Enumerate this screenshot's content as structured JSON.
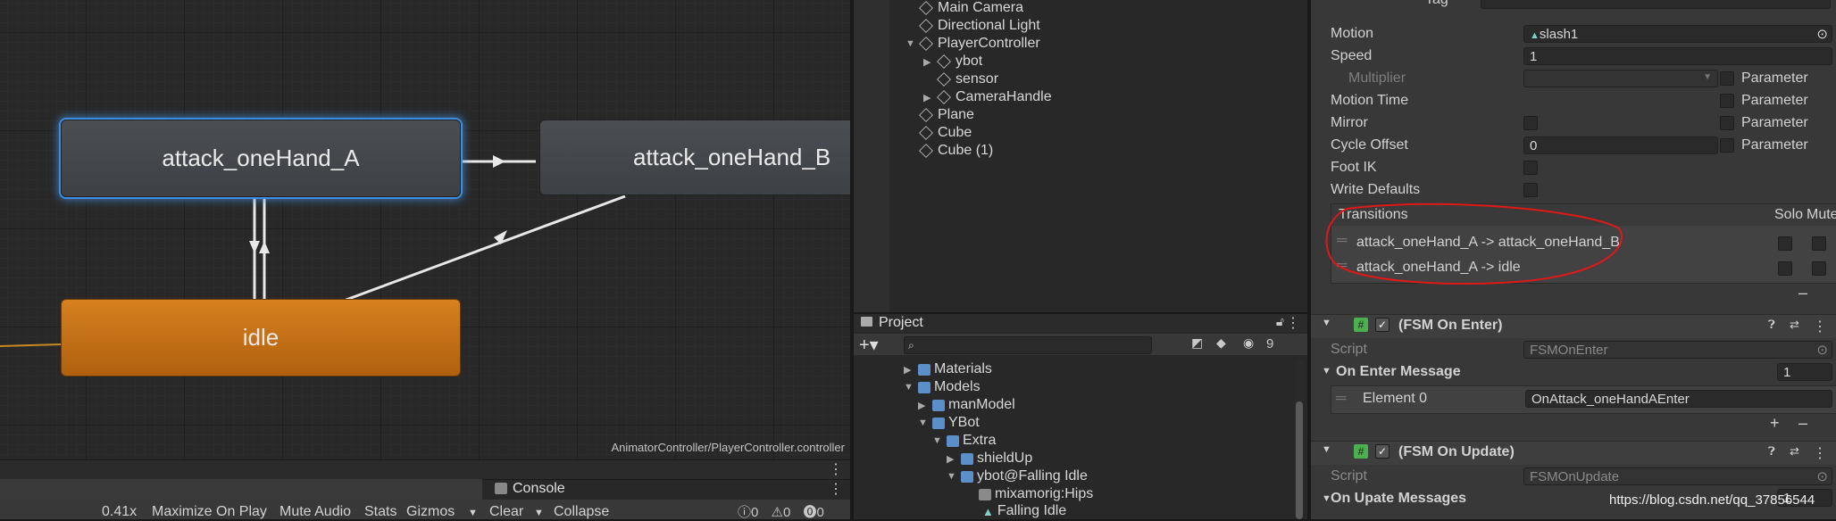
{
  "animator": {
    "nodes": {
      "attack_a": "attack_oneHand_A",
      "attack_b": "attack_oneHand_B",
      "idle": "idle"
    },
    "breadcrumb": "AnimatorController/PlayerController.controller"
  },
  "scene_toolbar": {
    "zoom": "0.41x",
    "maximize": "Maximize On Play",
    "mute": "Mute Audio",
    "stats": "Stats",
    "gizmos": "Gizmos"
  },
  "console": {
    "tab": "Console",
    "clear": "Clear",
    "collapse": "Collapse",
    "info": "0",
    "warn": "0",
    "err": "0"
  },
  "hierarchy": {
    "items": [
      "Main Camera",
      "Directional Light",
      "PlayerController",
      "ybot",
      "sensor",
      "CameraHandle",
      "Plane",
      "Cube",
      "Cube (1)"
    ]
  },
  "project": {
    "tab": "Project",
    "hidden_count": "9",
    "items": [
      "Materials",
      "Models",
      "manModel",
      "YBot",
      "Extra",
      "shieldUp",
      "ybot@Falling Idle",
      "mixamorig:Hips",
      "Falling Idle"
    ]
  },
  "inspector": {
    "tag": "Tag",
    "motion_label": "Motion",
    "motion_value": "slash1",
    "speed_label": "Speed",
    "speed_value": "1",
    "multiplier_label": "Multiplier",
    "motion_time_label": "Motion Time",
    "mirror_label": "Mirror",
    "cycle_label": "Cycle Offset",
    "cycle_value": "0",
    "footik_label": "Foot IK",
    "writedef_label": "Write Defaults",
    "parameter": "Parameter",
    "transitions_label": "Transitions",
    "solo": "Solo",
    "mute": "Mute",
    "transitions": [
      "attack_oneHand_A -> attack_oneHand_B",
      "attack_oneHand_A -> idle"
    ],
    "fsm_enter": "(FSM On Enter)",
    "script_label": "Script",
    "script_enter": "FSMOnEnter",
    "enter_msg": "On Enter Message",
    "enter_count": "1",
    "element0": "Element 0",
    "element0_value": "OnAttack_oneHandAEnter",
    "fsm_update": "(FSM On Update)",
    "script_update": "FSMOnUpdate",
    "update_msg": "On Upate Messages",
    "update_count": "1",
    "watermark": "https://blog.csdn.net/qq_37856544"
  }
}
